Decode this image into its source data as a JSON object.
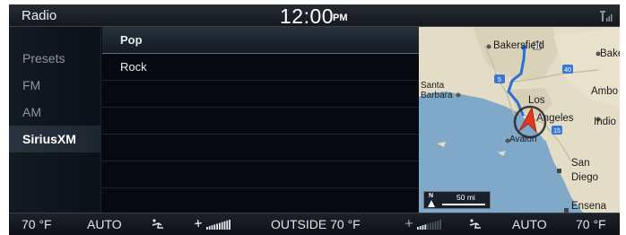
{
  "status": {
    "title": "Radio",
    "time": "12:00",
    "ampm": "PM"
  },
  "nav": {
    "items": [
      {
        "label": "Presets",
        "active": false
      },
      {
        "label": "FM",
        "active": false
      },
      {
        "label": "AM",
        "active": false
      },
      {
        "label": "SiriusXM",
        "active": true
      }
    ]
  },
  "list": {
    "rows": [
      {
        "label": "Pop",
        "selected": true
      },
      {
        "label": "Rock",
        "selected": false
      },
      {
        "label": "",
        "selected": false
      },
      {
        "label": "",
        "selected": false
      },
      {
        "label": "",
        "selected": false
      },
      {
        "label": "",
        "selected": false
      }
    ]
  },
  "map": {
    "labels": {
      "bakersfield": "Bakersfield",
      "bake": "Bake",
      "santa_barbara_1": "Santa",
      "santa_barbara_2": "Barbara",
      "los": "Los",
      "angeles": "Angeles",
      "ambo": "Ambo",
      "indio": "Indio",
      "avalon": "Avalon",
      "san": "San",
      "diego": "Diego",
      "ensena": "Ensena"
    },
    "highways": [
      "5",
      "40",
      "15"
    ],
    "scale_north": "N",
    "scale_label": "50 mi",
    "colors": {
      "land": "#e3dcc6",
      "water": "#7fa8c9",
      "route": "#2b6fd6",
      "position": "#e23a1f"
    }
  },
  "climate": {
    "left_temp": "70 °F",
    "left_mode": "AUTO",
    "outside": "OUTSIDE  70 °F",
    "right_mode": "AUTO",
    "right_temp": "70 °F",
    "left_fan_level": 1.0,
    "right_fan_level": 0.35
  }
}
